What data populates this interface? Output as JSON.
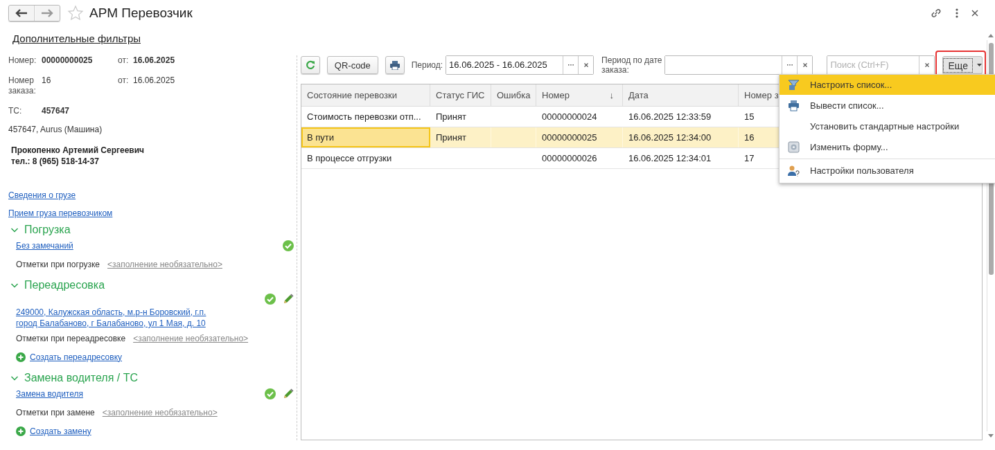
{
  "window": {
    "title": "АРМ Перевозчик",
    "favorite": false
  },
  "filters_link": "Дополнительные фильтры",
  "details": [
    {
      "label": "Номер:",
      "value": "00000000025",
      "date_label": "от:",
      "date": "16.06.2025",
      "bold": true
    },
    {
      "label": "Номер заказа:",
      "value": "16",
      "date_label": "от:",
      "date": "16.06.2025",
      "bold": false
    },
    {
      "label": "ТС:",
      "value": "457647",
      "bold": true
    }
  ],
  "vehicle": "457647, Aurus (Машина)",
  "driver": {
    "name": "Прокопенко Артемий Сергеевич",
    "phone": "тел.: 8 (965) 518-14-37"
  },
  "links": [
    "Сведения о грузе",
    "Прием груза перевозчиком"
  ],
  "sections": [
    {
      "title": "Погрузка",
      "expanded": true,
      "items": [
        {
          "kind": "link",
          "text": "Без замечаний",
          "done": true,
          "editable": false
        },
        {
          "kind": "note",
          "label": "Отметки при погрузке",
          "placeholder": "<заполнение необязательно>"
        }
      ]
    },
    {
      "title": "Переадресовка",
      "expanded": true,
      "items": [
        {
          "kind": "address",
          "text": "249000, Калужская область, м.р-н Боровский, г.п. город Балабаново, г Балабаново, ул 1 Мая, д. 10",
          "done": true,
          "editable": true
        },
        {
          "kind": "note",
          "label": "Отметки при переадресовке",
          "placeholder": "<заполнение необязательно>"
        },
        {
          "kind": "create",
          "text": "Создать переадресовку"
        }
      ]
    },
    {
      "title": "Замена водителя / ТС",
      "expanded": true,
      "items": [
        {
          "kind": "link",
          "text": "Замена водителя",
          "done": true,
          "editable": true
        },
        {
          "kind": "note",
          "label": "Отметки при замене",
          "placeholder": "<заполнение необязательно>"
        },
        {
          "kind": "create",
          "text": "Создать замену"
        }
      ]
    }
  ],
  "toolbar": {
    "qr_button": "QR-code",
    "period_label": "Период:",
    "period_value": "16.06.2025 - 16.06.2025",
    "order_period_label": "Период по дате заказа:",
    "search": {
      "placeholder": "Поиск (Ctrl+F)"
    },
    "more_button": "Еще",
    "more_open": true
  },
  "table": {
    "columns": [
      {
        "label": "Состояние перевозки"
      },
      {
        "label": "Статус ГИС"
      },
      {
        "label": "Ошибка"
      },
      {
        "label": "Номер",
        "sort": "↓"
      },
      {
        "label": "Дата"
      },
      {
        "label": "Номер з"
      }
    ],
    "rows": [
      {
        "cells": [
          "Стоимость перевозки отп...",
          "Принят",
          "",
          "00000000024",
          "16.06.2025 12:33:59",
          "15"
        ],
        "selected": false
      },
      {
        "cells": [
          "В пути",
          "Принят",
          "",
          "00000000025",
          "16.06.2025 12:34:00",
          "16"
        ],
        "selected": true
      },
      {
        "cells": [
          "В процессе отгрузки",
          "",
          "",
          "00000000026",
          "16.06.2025 12:34:01",
          "17"
        ],
        "selected": false
      }
    ]
  },
  "menu": {
    "items": [
      {
        "kind": "filter",
        "label": "Настроить список...",
        "highlighted": true,
        "separator_before": false
      },
      {
        "kind": "print",
        "label": "Вывести список...",
        "highlighted": false,
        "separator_before": false
      },
      {
        "kind": "plain",
        "label": "Установить стандартные настройки",
        "highlighted": false,
        "separator_before": false
      },
      {
        "kind": "form",
        "label": "Изменить форму...",
        "highlighted": false,
        "separator_before": false
      },
      {
        "kind": "user",
        "label": "Настройки пользователя",
        "highlighted": false,
        "separator_before": true
      }
    ]
  }
}
